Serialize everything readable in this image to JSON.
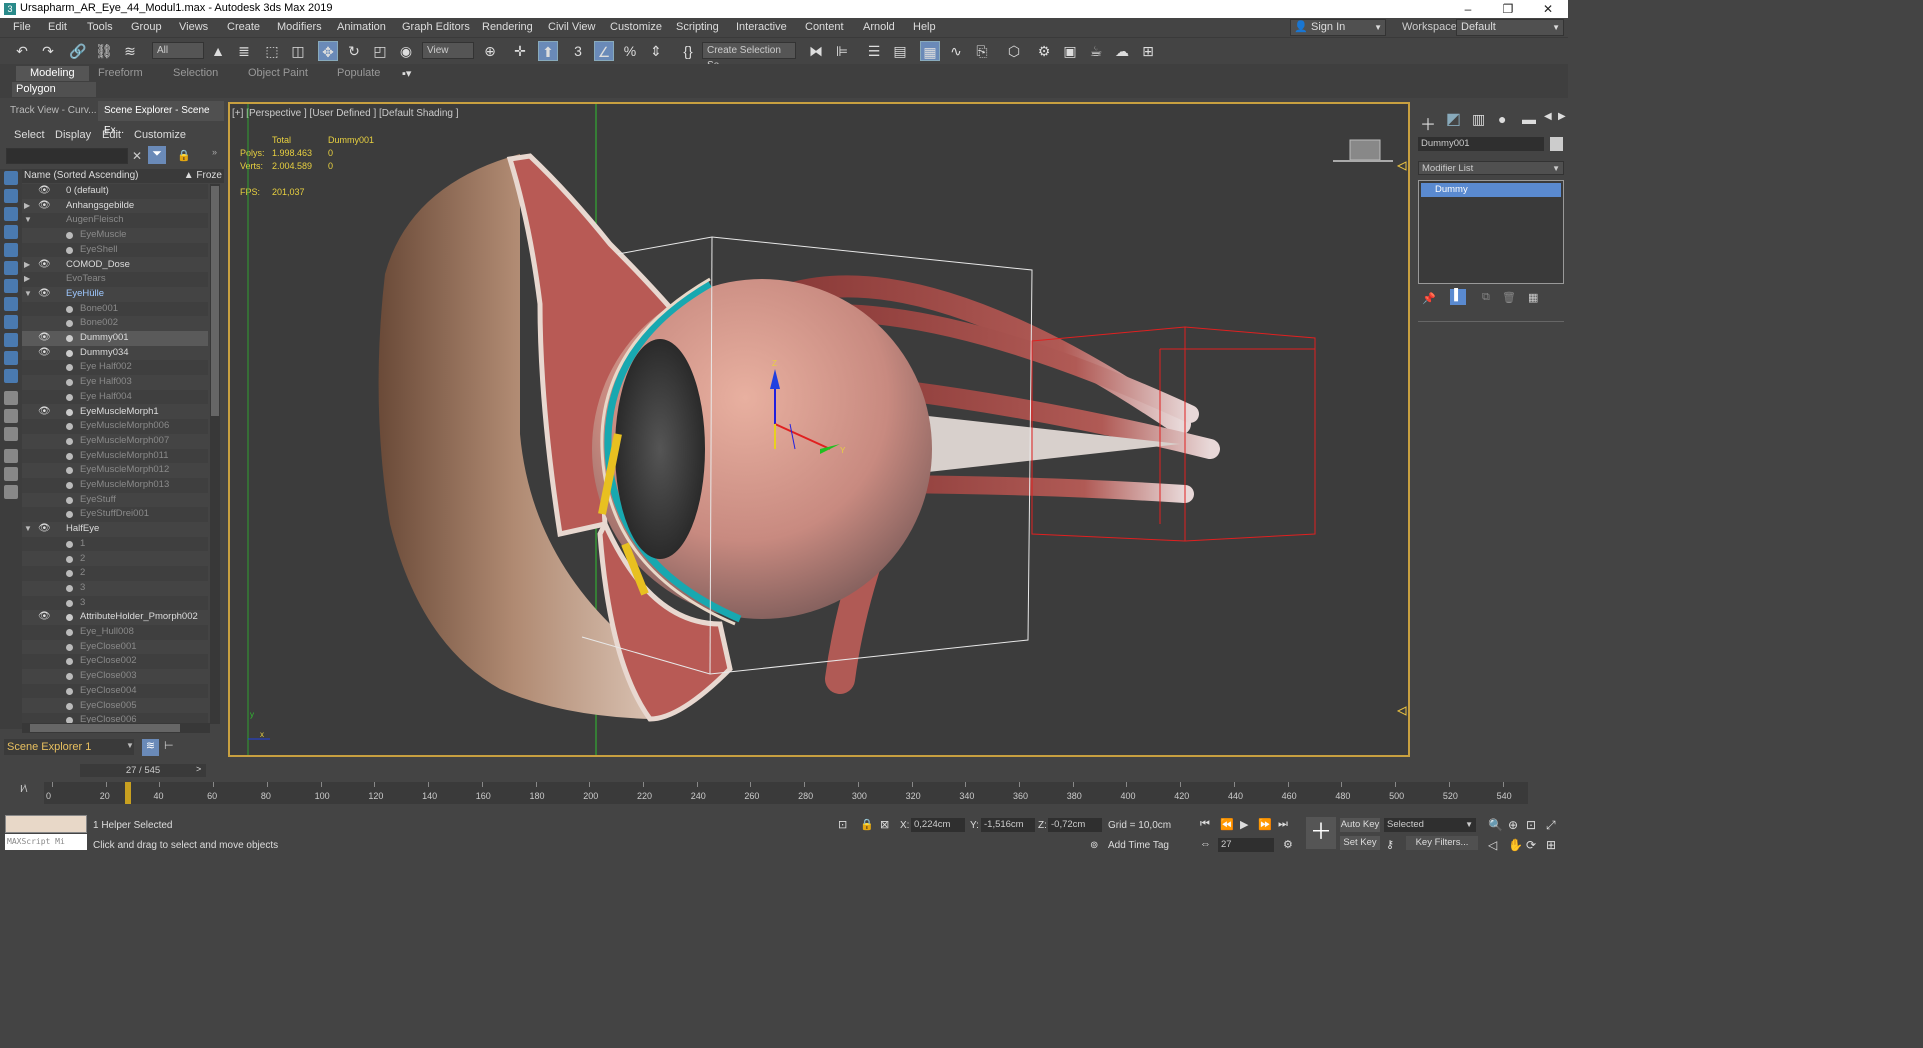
{
  "window": {
    "title": "Ursapharm_AR_Eye_44_Modul1.max - Autodesk 3ds Max 2019",
    "minimize": "–",
    "maximize": "❐",
    "close": "✕"
  },
  "menu": [
    "File",
    "Edit",
    "Tools",
    "Group",
    "Views",
    "Create",
    "Modifiers",
    "Animation",
    "Graph Editors",
    "Rendering",
    "Civil View",
    "Customize",
    "Scripting",
    "Interactive",
    "Content",
    "Arnold",
    "Help"
  ],
  "account": {
    "signin": "Sign In",
    "workspaces_label": "Workspaces:",
    "workspace": "Default"
  },
  "toolbar": {
    "filter": "All",
    "refcoord": "View",
    "selection_set": "Create Selection Se"
  },
  "ribbon": {
    "tabs": [
      "Modeling",
      "Freeform",
      "Selection",
      "Object Paint",
      "Populate"
    ],
    "panel": "Polygon Modeling"
  },
  "scene_explorer": {
    "tabs": [
      "Track View - Curv...",
      "Scene Explorer - Scene Ex..."
    ],
    "menu": [
      "Select",
      "Display",
      "Edit",
      "Customize"
    ],
    "col_name": "Name (Sorted Ascending)",
    "col_froze": "▲ Froze",
    "footer": "Scene Explorer 1",
    "rows": [
      {
        "name": "0 (default)",
        "level": 0,
        "eye": true,
        "exp": ""
      },
      {
        "name": "Anhangsgebilde",
        "level": 0,
        "eye": true,
        "exp": "▶"
      },
      {
        "name": "AugenFleisch",
        "level": 0,
        "eye": false,
        "exp": "▼",
        "dim": true
      },
      {
        "name": "EyeMuscle",
        "level": 1,
        "eye": false,
        "dim": true
      },
      {
        "name": "EyeShell",
        "level": 1,
        "eye": false,
        "dim": true
      },
      {
        "name": "COMOD_Dose",
        "level": 0,
        "eye": true,
        "exp": "▶"
      },
      {
        "name": "EvoTears",
        "level": 0,
        "eye": false,
        "exp": "▶",
        "dim": true
      },
      {
        "name": "EyeHülle",
        "level": 0,
        "eye": true,
        "exp": "▼",
        "hl": true
      },
      {
        "name": "Bone001",
        "level": 1,
        "eye": false,
        "dim": true
      },
      {
        "name": "Bone002",
        "level": 1,
        "eye": false,
        "dim": true
      },
      {
        "name": "Dummy001",
        "level": 1,
        "eye": true,
        "sel": true
      },
      {
        "name": "Dummy034",
        "level": 1,
        "eye": true
      },
      {
        "name": "Eye Half002",
        "level": 1,
        "eye": false,
        "dim": true
      },
      {
        "name": "Eye Half003",
        "level": 1,
        "eye": false,
        "dim": true
      },
      {
        "name": "Eye Half004",
        "level": 1,
        "eye": false,
        "dim": true
      },
      {
        "name": "EyeMuscleMorph1",
        "level": 1,
        "eye": true
      },
      {
        "name": "EyeMuscleMorph006",
        "level": 1,
        "eye": false,
        "dim": true
      },
      {
        "name": "EyeMuscleMorph007",
        "level": 1,
        "eye": false,
        "dim": true
      },
      {
        "name": "EyeMuscleMorph011",
        "level": 1,
        "eye": false,
        "dim": true
      },
      {
        "name": "EyeMuscleMorph012",
        "level": 1,
        "eye": false,
        "dim": true
      },
      {
        "name": "EyeMuscleMorph013",
        "level": 1,
        "eye": false,
        "dim": true
      },
      {
        "name": "EyeStuff",
        "level": 1,
        "eye": false,
        "dim": true
      },
      {
        "name": "EyeStuffDrei001",
        "level": 1,
        "eye": false,
        "dim": true
      },
      {
        "name": "HalfEye",
        "level": 0,
        "eye": true,
        "exp": "▼"
      },
      {
        "name": "1",
        "level": 1,
        "eye": false,
        "dim": true
      },
      {
        "name": "2",
        "level": 1,
        "eye": false,
        "dim": true
      },
      {
        "name": "2",
        "level": 1,
        "eye": false,
        "dim": true
      },
      {
        "name": "3",
        "level": 1,
        "eye": false,
        "dim": true
      },
      {
        "name": "3",
        "level": 1,
        "eye": false,
        "dim": true
      },
      {
        "name": "AttributeHolder_Pmorph002",
        "level": 1,
        "eye": true
      },
      {
        "name": "Eye_Hull008",
        "level": 1,
        "eye": false,
        "dim": true
      },
      {
        "name": "EyeClose001",
        "level": 1,
        "eye": false,
        "dim": true
      },
      {
        "name": "EyeClose002",
        "level": 1,
        "eye": false,
        "dim": true
      },
      {
        "name": "EyeClose003",
        "level": 1,
        "eye": false,
        "dim": true
      },
      {
        "name": "EyeClose004",
        "level": 1,
        "eye": false,
        "dim": true
      },
      {
        "name": "EyeClose005",
        "level": 1,
        "eye": false,
        "dim": true
      },
      {
        "name": "EyeClose006",
        "level": 1,
        "eye": false,
        "dim": true
      }
    ]
  },
  "viewport": {
    "label": "[+] [Perspective ] [User Defined ] [Default Shading ]",
    "stats_total": "Total",
    "stats_obj": "Dummy001",
    "polys_label": "Polys:",
    "polys_total": "1.998.463",
    "polys_obj": "0",
    "verts_label": "Verts:",
    "verts_total": "2.004.589",
    "verts_obj": "0",
    "fps_label": "FPS:",
    "fps": "201,037",
    "gizmo_z": "Z",
    "gizmo_y": "Y",
    "axis_x": "x",
    "axis_y": "y"
  },
  "command_panel": {
    "object_name": "Dummy001",
    "modifier_list": "Modifier List",
    "stack_item": "Dummy"
  },
  "timeline": {
    "frame": "27 / 545",
    "ticks": [
      0,
      20,
      40,
      60,
      80,
      100,
      120,
      140,
      160,
      180,
      200,
      220,
      240,
      260,
      280,
      300,
      320,
      340,
      360,
      380,
      400,
      420,
      440,
      460,
      480,
      500,
      520,
      540
    ]
  },
  "status": {
    "maxscript": "MAXScript Mi",
    "selected": "1 Helper Selected",
    "prompt": "Click and drag to select and move objects",
    "x_label": "X:",
    "x": "0,224cm",
    "y_label": "Y:",
    "y": "-1,516cm",
    "z_label": "Z:",
    "z": "-0,72cm",
    "grid": "Grid = 10,0cm",
    "add_time_tag": "Add Time Tag",
    "autokey": "Auto Key",
    "setkey": "Set Key",
    "selected_dd": "Selected",
    "key_filters": "Key Filters...",
    "current_frame": "27"
  }
}
